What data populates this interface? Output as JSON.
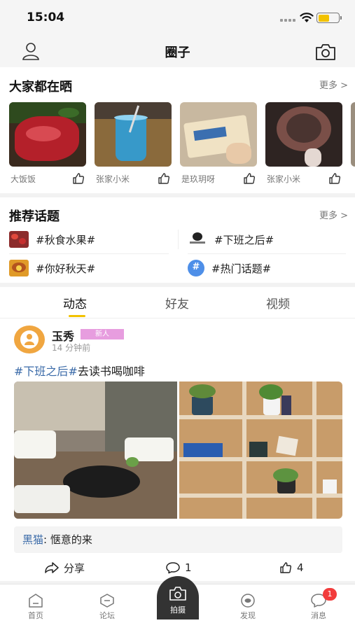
{
  "status": {
    "time": "15:04"
  },
  "header": {
    "title": "圈子",
    "user_icon": "user-icon",
    "camera_icon": "camera-icon"
  },
  "showcase": {
    "title": "大家都在晒",
    "more": "更多 >",
    "items": [
      {
        "user": "大饭饭",
        "image": "raw-steak-photo"
      },
      {
        "user": "张家小米",
        "image": "blue-drink-photo"
      },
      {
        "user": "是玖玥呀",
        "image": "bread-package-photo"
      },
      {
        "user": "张家小米",
        "image": "pottery-bowl-photo"
      }
    ]
  },
  "topics": {
    "title": "推荐话题",
    "more": "更多 >",
    "items": [
      {
        "label": "#秋食水果#"
      },
      {
        "label": "#下班之后#"
      },
      {
        "label": "#你好秋天#"
      },
      {
        "label": "#热门话题#"
      }
    ]
  },
  "tabs": [
    {
      "label": "动态",
      "active": true
    },
    {
      "label": "好友"
    },
    {
      "label": "视频"
    }
  ],
  "post": {
    "author": "玉秀",
    "badge": "新人",
    "time": "14 分钟前",
    "tag": "#下班之后#",
    "text": "去读书喝咖啡",
    "images": [
      "cafe-patio-photo",
      "bookshelf-photo"
    ],
    "comment": {
      "user": "黑猫",
      "sep": ": ",
      "text": "惬意的来"
    },
    "share_label": "分享",
    "comment_count": "1",
    "like_count": "4"
  },
  "tabbar": {
    "items": [
      {
        "label": "首页"
      },
      {
        "label": "论坛"
      },
      {
        "label": "拍摄"
      },
      {
        "label": "发现"
      },
      {
        "label": "消息",
        "badge": "1"
      }
    ]
  },
  "colors": {
    "accent": "#f2c200",
    "link": "#3a6aa8",
    "badge_pink": "#e79ddf",
    "notify_red": "#f23c3c"
  }
}
